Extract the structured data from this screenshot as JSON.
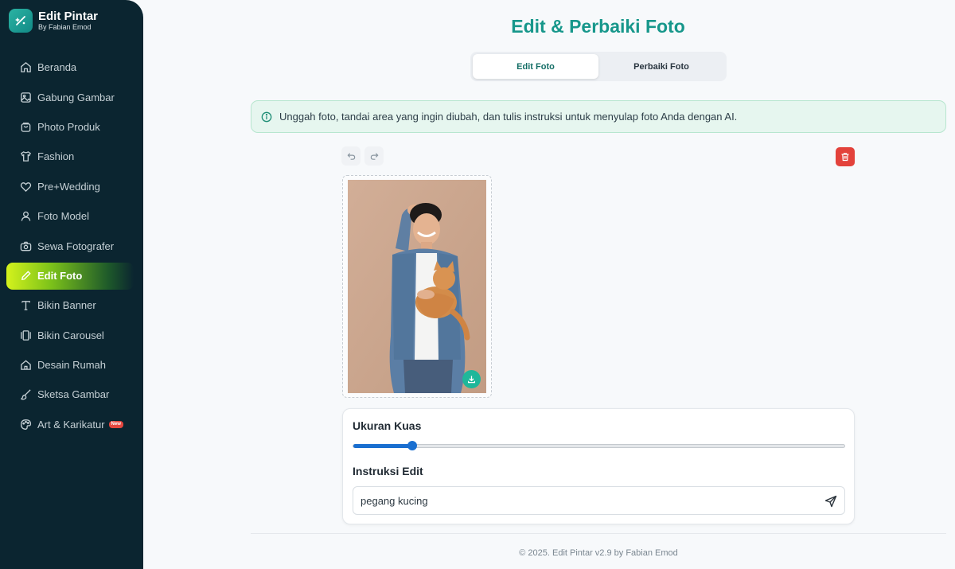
{
  "brand": {
    "title": "Edit Pintar",
    "subtitle": "By Fabian Emod"
  },
  "sidebar": {
    "items": [
      {
        "label": "Beranda",
        "icon": "home-icon"
      },
      {
        "label": "Gabung Gambar",
        "icon": "image-icon"
      },
      {
        "label": "Photo Produk",
        "icon": "bag-icon"
      },
      {
        "label": "Fashion",
        "icon": "shirt-icon"
      },
      {
        "label": "Pre+Wedding",
        "icon": "heart-icon"
      },
      {
        "label": "Foto Model",
        "icon": "user-icon"
      },
      {
        "label": "Sewa Fotografer",
        "icon": "camera-icon"
      },
      {
        "label": "Edit Foto",
        "icon": "pencil-icon",
        "active": true
      },
      {
        "label": "Bikin Banner",
        "icon": "text-icon"
      },
      {
        "label": "Bikin Carousel",
        "icon": "carousel-icon"
      },
      {
        "label": "Desain Rumah",
        "icon": "house-icon"
      },
      {
        "label": "Sketsa Gambar",
        "icon": "brush-icon"
      },
      {
        "label": "Art & Karikatur",
        "icon": "palette-icon",
        "badge": "New"
      }
    ]
  },
  "main": {
    "title": "Edit & Perbaiki Foto",
    "tabs": [
      {
        "label": "Edit Foto",
        "active": true
      },
      {
        "label": "Perbaiki Foto",
        "active": false
      }
    ],
    "info": "Unggah foto, tandai area yang ingin diubah, dan tulis instruksi untuk menyulap foto Anda dengan AI.",
    "brush": {
      "label": "Ukuran Kuas",
      "value_fraction": 0.12
    },
    "instruction": {
      "label": "Instruksi Edit",
      "value": "pegang kucing"
    }
  },
  "footer": "© 2025. Edit Pintar v2.9 by Fabian Emod",
  "colors": {
    "accent": "#17978b",
    "sidebar_bg": "#0b2530",
    "active_gradient_start": "#d4f21c",
    "danger": "#e3423b",
    "slider": "#1a6fd0"
  }
}
